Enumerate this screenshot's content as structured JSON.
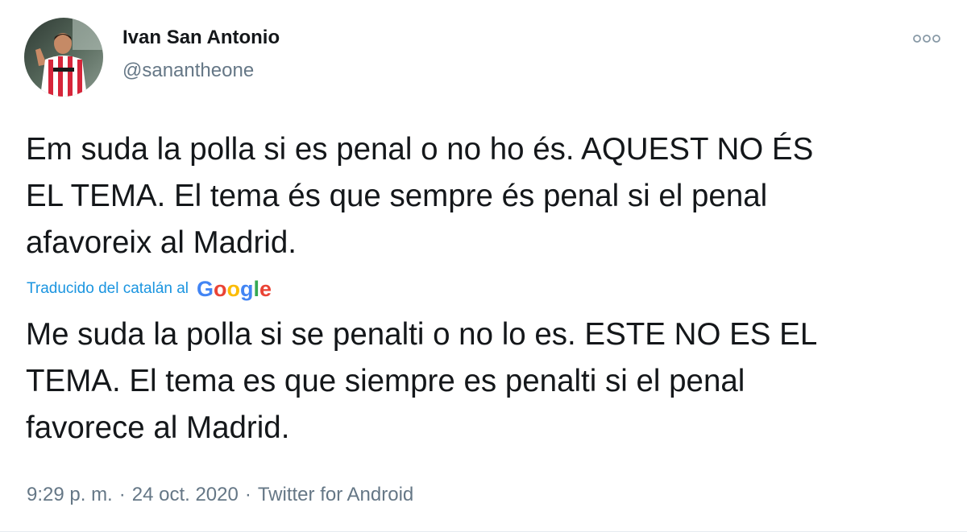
{
  "tweet": {
    "author": {
      "name": "Ivan San Antonio",
      "handle": "@sanantheone",
      "avatar_icon": "avatar-photo"
    },
    "menu_icon": "more-options-icon",
    "original_text_lines": [
      "Em suda la polla si es penal o no ho és. AQUEST NO ÉS",
      "EL TEMA. El tema és que sempre és penal si el penal",
      "afavoreix al Madrid."
    ],
    "translation": {
      "label": "Traducido del catalán al",
      "provider": "Google",
      "text_lines": [
        "Me suda la polla si se penalti o no lo es. ESTE NO ES EL",
        "TEMA. El tema es que siempre es penalti si el penal",
        "favorece al Madrid."
      ]
    },
    "time": "9:29 p. m.",
    "separator": "·",
    "date": "24 oct. 2020",
    "source": "Twitter for Android"
  },
  "colors": {
    "text": "#14171a",
    "secondary": "#657786",
    "link": "#1b95e0",
    "google_blue": "#4285f4",
    "google_red": "#ea4335",
    "google_yellow": "#fbbc05",
    "google_green": "#34a853"
  }
}
